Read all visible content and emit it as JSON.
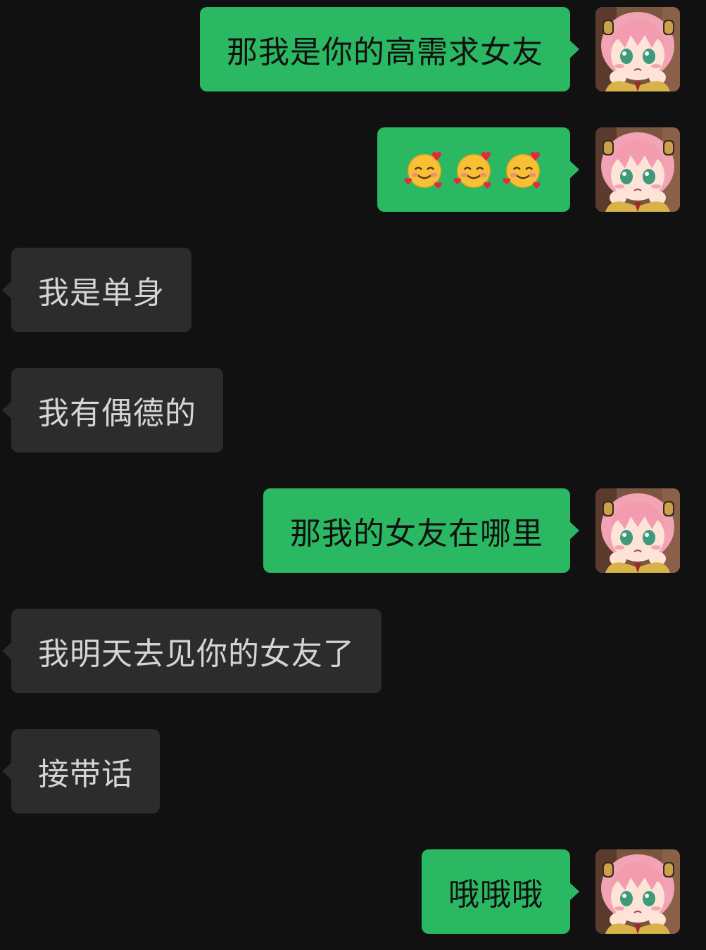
{
  "messages": [
    {
      "side": "sent",
      "text": "那我是你的高需求女友"
    },
    {
      "side": "sent",
      "emoji": [
        "smiling-face-with-hearts",
        "smiling-face-with-hearts",
        "smiling-face-with-hearts"
      ]
    },
    {
      "side": "received",
      "text": "我是单身"
    },
    {
      "side": "received",
      "text": "我有偶德的"
    },
    {
      "side": "sent",
      "text": "那我的女友在哪里"
    },
    {
      "side": "received",
      "text": "我明天去见你的女友了"
    },
    {
      "side": "received",
      "text": "接带话"
    },
    {
      "side": "sent",
      "text": "哦哦哦"
    }
  ],
  "colors": {
    "background": "#111111",
    "sent_bubble": "#2ab962",
    "received_bubble": "#2c2c2c",
    "received_text": "#d5d5d5"
  }
}
